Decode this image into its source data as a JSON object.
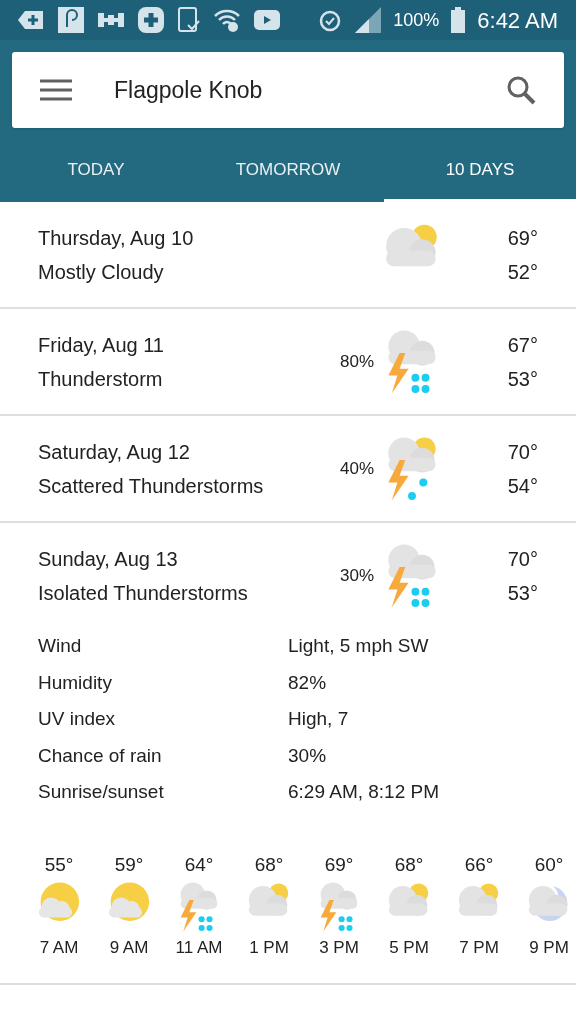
{
  "status_bar": {
    "battery": "100%",
    "time": "6:42 AM"
  },
  "search_bar": {
    "location": "Flagpole Knob"
  },
  "tabs": [
    {
      "label": "TODAY",
      "selected": false
    },
    {
      "label": "TOMORROW",
      "selected": false
    },
    {
      "label": "10 DAYS",
      "selected": true
    }
  ],
  "days": [
    {
      "date": "Thursday, Aug 10",
      "condition": "Mostly Cloudy",
      "kind": "cloud_sun",
      "high": "69°",
      "low": "52°"
    },
    {
      "date": "Friday, Aug 11",
      "condition": "Thunderstorm",
      "kind": "storm",
      "precip": "80%",
      "high": "67°",
      "low": "53°"
    },
    {
      "date": "Saturday, Aug 12",
      "condition": "Scattered Thunderstorms",
      "kind": "storm_sun",
      "precip": "40%",
      "high": "70°",
      "low": "54°"
    },
    {
      "date": "Sunday, Aug 13",
      "condition": "Isolated Thunderstorms",
      "kind": "storm",
      "precip": "30%",
      "high": "70°",
      "low": "53°",
      "expanded": true,
      "details": [
        {
          "label": "Wind",
          "value": "Light, 5 mph SW"
        },
        {
          "label": "Humidity",
          "value": "82%"
        },
        {
          "label": "UV index",
          "value": "High, 7"
        },
        {
          "label": "Chance of rain",
          "value": "30%"
        },
        {
          "label": "Sunrise/sunset",
          "value": "6:29 AM, 8:12 PM"
        }
      ],
      "hourly": [
        {
          "temp": "55°",
          "kind": "sun_cloud",
          "time": "7 AM"
        },
        {
          "temp": "59°",
          "kind": "sun_cloud",
          "time": "9 AM"
        },
        {
          "temp": "64°",
          "kind": "storm",
          "time": "11 AM"
        },
        {
          "temp": "68°",
          "kind": "cloud_sun",
          "time": "1 PM"
        },
        {
          "temp": "69°",
          "kind": "storm",
          "time": "3 PM"
        },
        {
          "temp": "68°",
          "kind": "cloud_sun",
          "time": "5 PM"
        },
        {
          "temp": "66°",
          "kind": "cloud_sun",
          "time": "7 PM"
        },
        {
          "temp": "60°",
          "kind": "moon_cloud",
          "time": "9 PM"
        }
      ]
    }
  ]
}
